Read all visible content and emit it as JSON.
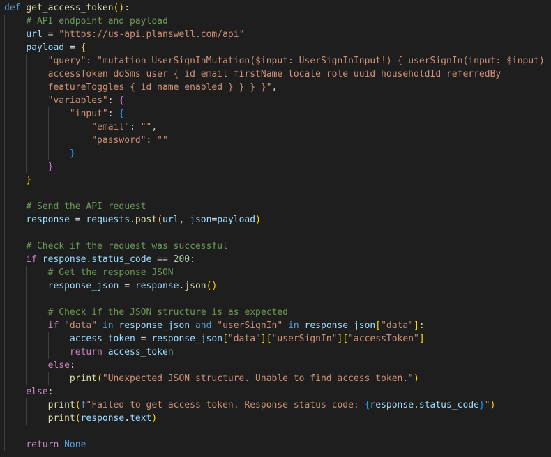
{
  "editor": {
    "language": "python",
    "theme": "Dark+",
    "colors": {
      "background": "#1e1e1e",
      "text": "#d4d4d4",
      "keyword": "#569cd6",
      "control_keyword": "#c586c0",
      "function": "#dcdcaa",
      "variable": "#9cdcfe",
      "string": "#ce9178",
      "comment": "#6a9955",
      "number": "#b5cea8",
      "bracket_level_1": "#ffd700",
      "bracket_level_2": "#da70d6",
      "bracket_level_3": "#179fff",
      "indent_guide": "#404040"
    },
    "lines": [
      {
        "tokens": [
          {
            "t": "def",
            "c": "kw"
          },
          {
            "t": " ",
            "c": "pn"
          },
          {
            "t": "get_access_token",
            "c": "fn"
          },
          {
            "t": "(",
            "c": "b1"
          },
          {
            "t": ")",
            "c": "b1"
          },
          {
            "t": ":",
            "c": "pn"
          }
        ]
      },
      {
        "indent": 1,
        "tokens": [
          {
            "t": "# API endpoint and payload",
            "c": "cm"
          }
        ]
      },
      {
        "indent": 1,
        "tokens": [
          {
            "t": "url",
            "c": "var"
          },
          {
            "t": " = ",
            "c": "op"
          },
          {
            "t": "\"",
            "c": "str"
          },
          {
            "t": "https://us-api.planswell.com/api",
            "c": "str url"
          },
          {
            "t": "\"",
            "c": "str"
          }
        ]
      },
      {
        "indent": 1,
        "tokens": [
          {
            "t": "payload",
            "c": "var"
          },
          {
            "t": " = ",
            "c": "op"
          },
          {
            "t": "{",
            "c": "b1"
          }
        ]
      },
      {
        "indent": 2,
        "tokens": [
          {
            "t": "\"query\"",
            "c": "str"
          },
          {
            "t": ": ",
            "c": "pn"
          },
          {
            "t": "\"mutation UserSignInMutation($input: UserSignInInput!) { userSignIn(input: $input) {",
            "c": "str"
          }
        ]
      },
      {
        "indent": 2,
        "tokens": [
          {
            "t": "accessToken doSms user { id email firstName locale role uuid householdId referredBy",
            "c": "str"
          }
        ]
      },
      {
        "indent": 2,
        "tokens": [
          {
            "t": "featureToggles { id name enabled } } } }\"",
            "c": "str"
          },
          {
            "t": ",",
            "c": "pn"
          }
        ]
      },
      {
        "indent": 2,
        "tokens": [
          {
            "t": "\"variables\"",
            "c": "str"
          },
          {
            "t": ": ",
            "c": "pn"
          },
          {
            "t": "{",
            "c": "b2"
          }
        ]
      },
      {
        "indent": 3,
        "tokens": [
          {
            "t": "\"input\"",
            "c": "str"
          },
          {
            "t": ": ",
            "c": "pn"
          },
          {
            "t": "{",
            "c": "b3"
          }
        ]
      },
      {
        "indent": 4,
        "tokens": [
          {
            "t": "\"email\"",
            "c": "str"
          },
          {
            "t": ": ",
            "c": "pn"
          },
          {
            "t": "\"\"",
            "c": "str"
          },
          {
            "t": ",",
            "c": "pn"
          }
        ]
      },
      {
        "indent": 4,
        "tokens": [
          {
            "t": "\"password\"",
            "c": "str"
          },
          {
            "t": ": ",
            "c": "pn"
          },
          {
            "t": "\"\"",
            "c": "str"
          }
        ]
      },
      {
        "indent": 3,
        "tokens": [
          {
            "t": "}",
            "c": "b3"
          }
        ]
      },
      {
        "indent": 2,
        "tokens": [
          {
            "t": "}",
            "c": "b2"
          }
        ]
      },
      {
        "indent": 1,
        "tokens": [
          {
            "t": "}",
            "c": "b1"
          }
        ]
      },
      {
        "indent": 1,
        "tokens": []
      },
      {
        "indent": 1,
        "tokens": [
          {
            "t": "# Send the API request",
            "c": "cm"
          }
        ]
      },
      {
        "indent": 1,
        "tokens": [
          {
            "t": "response",
            "c": "var"
          },
          {
            "t": " = ",
            "c": "op"
          },
          {
            "t": "requests",
            "c": "var"
          },
          {
            "t": ".",
            "c": "pn"
          },
          {
            "t": "post",
            "c": "fn"
          },
          {
            "t": "(",
            "c": "b1"
          },
          {
            "t": "url",
            "c": "var"
          },
          {
            "t": ", ",
            "c": "pn"
          },
          {
            "t": "json",
            "c": "var"
          },
          {
            "t": "=",
            "c": "op"
          },
          {
            "t": "payload",
            "c": "var"
          },
          {
            "t": ")",
            "c": "b1"
          }
        ]
      },
      {
        "indent": 1,
        "tokens": []
      },
      {
        "indent": 1,
        "tokens": [
          {
            "t": "# Check if the request was successful",
            "c": "cm"
          }
        ]
      },
      {
        "indent": 1,
        "tokens": [
          {
            "t": "if",
            "c": "kw2"
          },
          {
            "t": " ",
            "c": "pn"
          },
          {
            "t": "response",
            "c": "var"
          },
          {
            "t": ".",
            "c": "pn"
          },
          {
            "t": "status_code",
            "c": "var"
          },
          {
            "t": " == ",
            "c": "op"
          },
          {
            "t": "200",
            "c": "num"
          },
          {
            "t": ":",
            "c": "pn"
          }
        ]
      },
      {
        "indent": 2,
        "tokens": [
          {
            "t": "# Get the response JSON",
            "c": "cm"
          }
        ]
      },
      {
        "indent": 2,
        "tokens": [
          {
            "t": "response_json",
            "c": "var"
          },
          {
            "t": " = ",
            "c": "op"
          },
          {
            "t": "response",
            "c": "var"
          },
          {
            "t": ".",
            "c": "pn"
          },
          {
            "t": "json",
            "c": "fn"
          },
          {
            "t": "(",
            "c": "b1"
          },
          {
            "t": ")",
            "c": "b1"
          }
        ]
      },
      {
        "indent": 2,
        "tokens": []
      },
      {
        "indent": 2,
        "tokens": [
          {
            "t": "# Check if the JSON structure is as expected",
            "c": "cm"
          }
        ]
      },
      {
        "indent": 2,
        "tokens": [
          {
            "t": "if",
            "c": "kw2"
          },
          {
            "t": " ",
            "c": "pn"
          },
          {
            "t": "\"data\"",
            "c": "str"
          },
          {
            "t": " ",
            "c": "pn"
          },
          {
            "t": "in",
            "c": "kw"
          },
          {
            "t": " ",
            "c": "pn"
          },
          {
            "t": "response_json",
            "c": "var"
          },
          {
            "t": " ",
            "c": "pn"
          },
          {
            "t": "and",
            "c": "kw"
          },
          {
            "t": " ",
            "c": "pn"
          },
          {
            "t": "\"userSignIn\"",
            "c": "str"
          },
          {
            "t": " ",
            "c": "pn"
          },
          {
            "t": "in",
            "c": "kw"
          },
          {
            "t": " ",
            "c": "pn"
          },
          {
            "t": "response_json",
            "c": "var"
          },
          {
            "t": "[",
            "c": "b1"
          },
          {
            "t": "\"data\"",
            "c": "str"
          },
          {
            "t": "]",
            "c": "b1"
          },
          {
            "t": ":",
            "c": "pn"
          }
        ]
      },
      {
        "indent": 3,
        "tokens": [
          {
            "t": "access_token",
            "c": "var"
          },
          {
            "t": " = ",
            "c": "op"
          },
          {
            "t": "response_json",
            "c": "var"
          },
          {
            "t": "[",
            "c": "b1"
          },
          {
            "t": "\"data\"",
            "c": "str"
          },
          {
            "t": "]",
            "c": "b1"
          },
          {
            "t": "[",
            "c": "b1"
          },
          {
            "t": "\"userSignIn\"",
            "c": "str"
          },
          {
            "t": "]",
            "c": "b1"
          },
          {
            "t": "[",
            "c": "b1"
          },
          {
            "t": "\"accessToken\"",
            "c": "str"
          },
          {
            "t": "]",
            "c": "b1"
          }
        ]
      },
      {
        "indent": 3,
        "tokens": [
          {
            "t": "return",
            "c": "kw2"
          },
          {
            "t": " ",
            "c": "pn"
          },
          {
            "t": "access_token",
            "c": "var"
          }
        ]
      },
      {
        "indent": 2,
        "tokens": [
          {
            "t": "else",
            "c": "kw2"
          },
          {
            "t": ":",
            "c": "pn"
          }
        ]
      },
      {
        "indent": 3,
        "tokens": [
          {
            "t": "print",
            "c": "fn"
          },
          {
            "t": "(",
            "c": "b1"
          },
          {
            "t": "\"Unexpected JSON structure. Unable to find access token.\"",
            "c": "str"
          },
          {
            "t": ")",
            "c": "b1"
          }
        ]
      },
      {
        "indent": 1,
        "tokens": [
          {
            "t": "else",
            "c": "kw2"
          },
          {
            "t": ":",
            "c": "pn"
          }
        ]
      },
      {
        "indent": 2,
        "tokens": [
          {
            "t": "print",
            "c": "fn"
          },
          {
            "t": "(",
            "c": "b1"
          },
          {
            "t": "f",
            "c": "kw"
          },
          {
            "t": "\"Failed to get access token. Response status code: ",
            "c": "str"
          },
          {
            "t": "{",
            "c": "b3"
          },
          {
            "t": "response",
            "c": "var"
          },
          {
            "t": ".",
            "c": "pn"
          },
          {
            "t": "status_code",
            "c": "var"
          },
          {
            "t": "}",
            "c": "b3"
          },
          {
            "t": "\"",
            "c": "str"
          },
          {
            "t": ")",
            "c": "b1"
          }
        ]
      },
      {
        "indent": 2,
        "tokens": [
          {
            "t": "print",
            "c": "fn"
          },
          {
            "t": "(",
            "c": "b1"
          },
          {
            "t": "response",
            "c": "var"
          },
          {
            "t": ".",
            "c": "pn"
          },
          {
            "t": "text",
            "c": "var"
          },
          {
            "t": ")",
            "c": "b1"
          }
        ]
      },
      {
        "indent": 1,
        "tokens": []
      },
      {
        "indent": 1,
        "tokens": [
          {
            "t": "return",
            "c": "kw2"
          },
          {
            "t": " ",
            "c": "pn"
          },
          {
            "t": "None",
            "c": "kw"
          }
        ]
      }
    ]
  }
}
